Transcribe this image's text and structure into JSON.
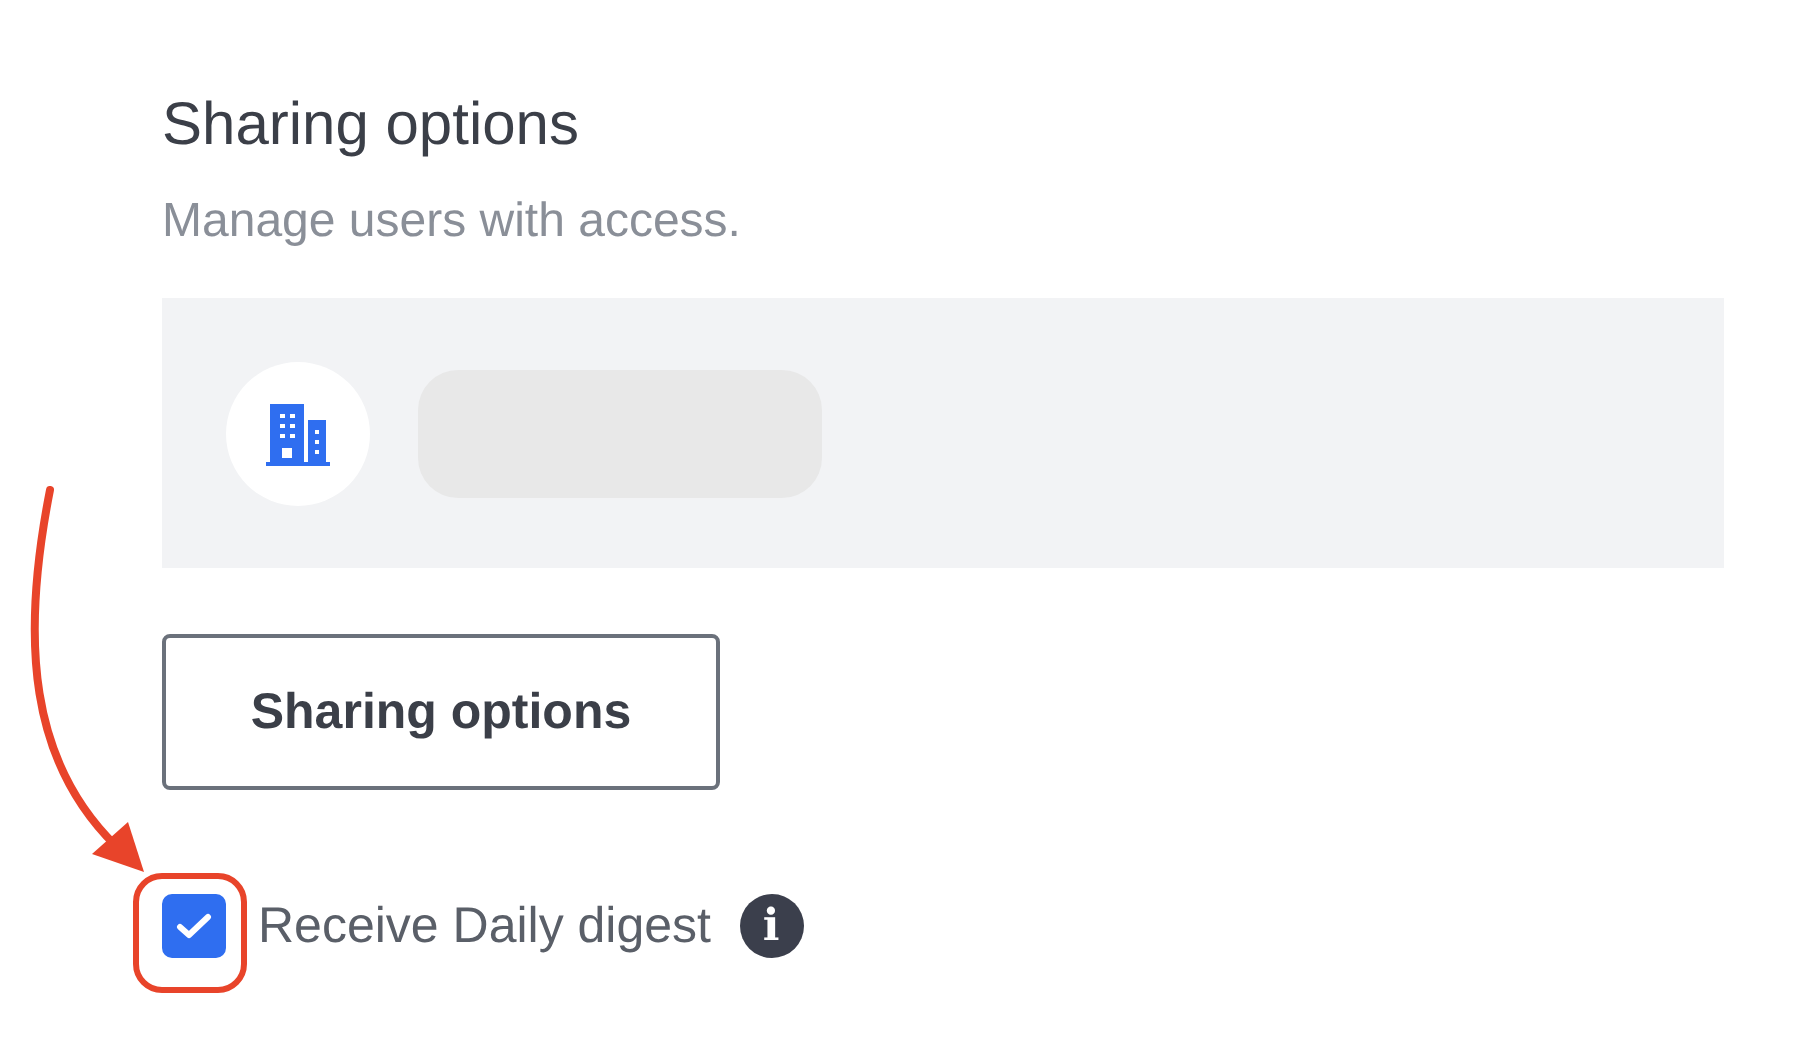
{
  "section": {
    "title": "Sharing options",
    "subtitle": "Manage users with access."
  },
  "button": {
    "label": "Sharing options"
  },
  "digest": {
    "label": "Receive Daily digest",
    "checked": true,
    "info_icon": "i"
  }
}
